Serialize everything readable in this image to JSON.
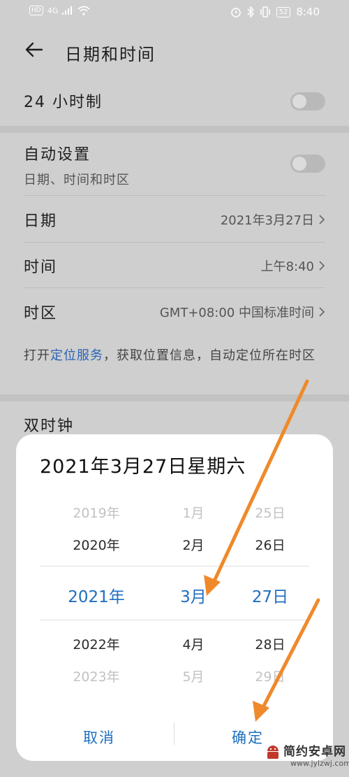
{
  "status_bar": {
    "left_badges": [
      "HD",
      "4G"
    ],
    "battery": "52",
    "time": "8:40"
  },
  "header": {
    "title": "日期和时间"
  },
  "settings": {
    "clock_24h": {
      "label": "24 小时制",
      "enabled": false
    },
    "auto_set": {
      "label": "自动设置",
      "sublabel": "日期、时间和时区",
      "enabled": false
    },
    "date": {
      "label": "日期",
      "value": "2021年3月27日"
    },
    "time": {
      "label": "时间",
      "value": "上午8:40"
    },
    "timezone": {
      "label": "时区",
      "value": "GMT+08:00 中国标准时间"
    }
  },
  "note": {
    "prefix": "打开",
    "link": "定位服务",
    "suffix": "，获取位置信息，自动定位所在时区"
  },
  "dual_clock": {
    "label": "双时钟"
  },
  "dialog": {
    "title": "2021年3月27日星期六",
    "years": [
      "2019年",
      "2020年",
      "2021年",
      "2022年",
      "2023年"
    ],
    "months": [
      "1月",
      "2月",
      "3月",
      "4月",
      "5月"
    ],
    "days": [
      "25日",
      "26日",
      "27日",
      "28日",
      "29日"
    ],
    "cancel": "取消",
    "confirm": "确定"
  },
  "watermark": {
    "text": "简约安卓网",
    "url": "www.jylzwj.com"
  },
  "colors": {
    "accent": "#1f6fc0",
    "arrow": "#f0892a",
    "overlay_bg": "#cfcfcf"
  }
}
